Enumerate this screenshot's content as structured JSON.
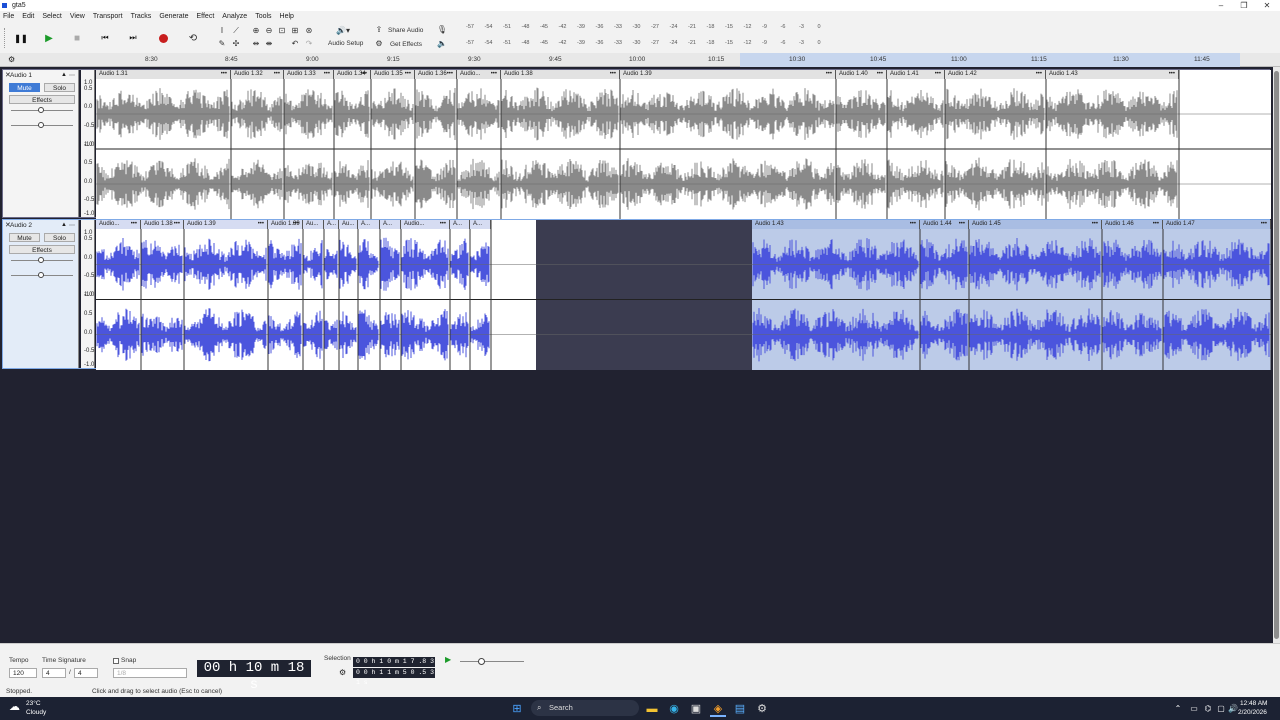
{
  "app": {
    "title": "gta5"
  },
  "menu": [
    "File",
    "Edit",
    "Select",
    "View",
    "Transport",
    "Tracks",
    "Generate",
    "Effect",
    "Analyze",
    "Tools",
    "Help"
  ],
  "toolbar": {
    "audio_setup": "Audio Setup",
    "share_audio": "Share Audio",
    "get_effects": "Get Effects"
  },
  "meter_rec": [
    "-57",
    "-54",
    "-51",
    "-48",
    "-45",
    "-42",
    "-39",
    "-36",
    "-33",
    "-30",
    "-27",
    "-24",
    "-21",
    "-18",
    "-15",
    "-12",
    "-9",
    "-6",
    "-3",
    "0"
  ],
  "meter_play": [
    "-57",
    "-54",
    "-51",
    "-48",
    "-45",
    "-42",
    "-39",
    "-36",
    "-33",
    "-30",
    "-27",
    "-24",
    "-21",
    "-18",
    "-15",
    "-12",
    "-9",
    "-6",
    "-3",
    "0"
  ],
  "ruler": [
    "8:30",
    "8:45",
    "9:00",
    "9:15",
    "9:30",
    "9:45",
    "10:00",
    "10:15",
    "10:30",
    "10:45",
    "11:00",
    "11:15",
    "11:30",
    "11:45"
  ],
  "scale_labels": [
    "1.0",
    "0.5",
    "0.0",
    "-0.5",
    "-1.0"
  ],
  "colors": {
    "track1_wave": "#8a8a8a",
    "track2_wave": "#4b55dd",
    "selection": "#bccbe8",
    "background": "#212230"
  },
  "tracks": [
    {
      "name": "Audio 1",
      "mute": "Mute",
      "solo": "Solo",
      "effects": "Effects",
      "clips": [
        "Audio 1.31",
        "Audio 1.32",
        "Audio 1.33",
        "Audio 1.34",
        "Audio 1.35",
        "Audio 1.36",
        "Audio...",
        "Audio 1.38",
        "Audio 1.39",
        "Audio 1.40",
        "Audio 1.41",
        "Audio 1.42",
        "Audio 1.43"
      ]
    },
    {
      "name": "Audio 2",
      "mute": "Mute",
      "solo": "Solo",
      "effects": "Effects",
      "clips": [
        "Audio...",
        "Audio 1.38",
        "Audio 1.39",
        "Audio 1.39",
        "Au...",
        "A...",
        "Au...",
        "A...",
        "A...",
        "Audio...",
        "A...",
        "A...",
        "Audio 1.43",
        "Audio 1.44",
        "Audio 1.45",
        "Audio 1.46",
        "Audio 1.47"
      ]
    }
  ],
  "bottom": {
    "tempo_label": "Tempo",
    "tempo": "120",
    "ts_label": "Time Signature",
    "ts_num": "4",
    "ts_den": "4",
    "snap": "Snap",
    "snap_value": "1/8",
    "time": "00 h 10 m 18 s",
    "selection_label": "Selection",
    "sel_start": "0 0 h 1 0 m 1 7 .8 3 7 s",
    "sel_end": "0 0 h 1 1 m 5 0 .5 3 1 s",
    "status_left": "Stopped.",
    "status_right": "Click and drag to select audio (Esc to cancel)"
  },
  "taskbar": {
    "temp": "23°C",
    "weather": "Cloudy",
    "search": "Search",
    "time": "12:48 AM",
    "date": "2/20/2026"
  }
}
